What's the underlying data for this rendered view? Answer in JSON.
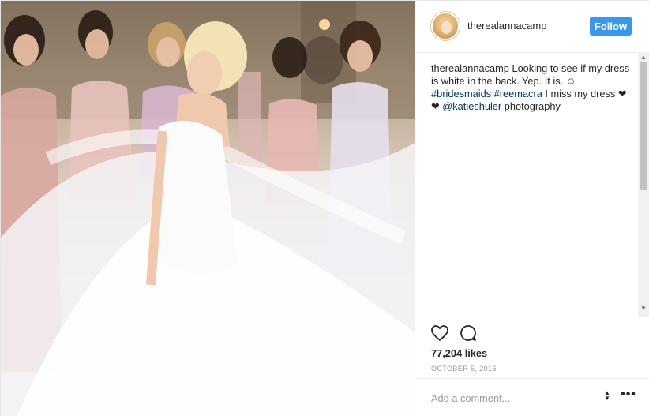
{
  "photo": {
    "alt_icon": "wedding-photo",
    "accent": "#f3f0ee"
  },
  "header": {
    "username": "therealannacamp",
    "follow_label": "Follow",
    "follow_color": "#3897f0"
  },
  "caption": {
    "username": "therealannacamp",
    "text_1": " Looking to see if my dress is white in the back. Yep. It is. ",
    "emoji": "☺",
    "hashtag_1": "#bridesmaids",
    "hashtag_2": "#reemacra",
    "text_2": " I miss my dress ",
    "hearts": "❤",
    "mention": "@katieshuler",
    "text_3": " photography",
    "link_color": "#003569"
  },
  "actions": {
    "like_icon": "heart-icon",
    "comment_icon": "comment-icon",
    "likes": "77,204 likes",
    "date": "OCTOBER 5, 2016"
  },
  "composer": {
    "placeholder": "Add a comment...",
    "more_label": "•••"
  }
}
